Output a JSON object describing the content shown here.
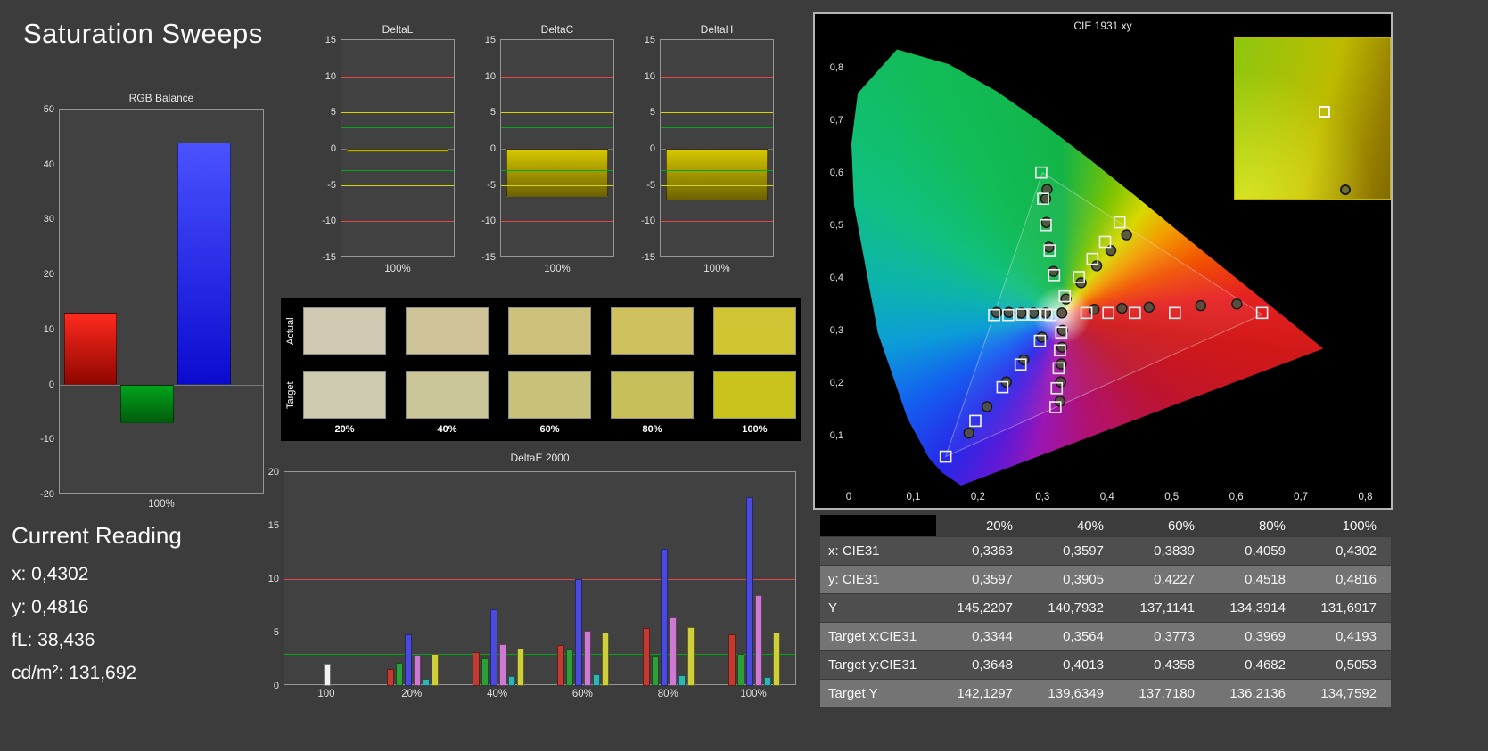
{
  "page": {
    "title": "Saturation Sweeps",
    "bg": "#3c3c3c"
  },
  "current_reading": {
    "heading": "Current Reading",
    "lines": [
      "x: 0,4302",
      "y: 0,4816",
      "fL: 38,436",
      "cd/m²: 131,692"
    ]
  },
  "rgb_balance": {
    "type": "bar",
    "title": "RGB Balance",
    "categories": [
      "Red",
      "Green",
      "Blue"
    ],
    "values": [
      13,
      -7,
      44
    ],
    "gradients": [
      [
        "#ff2a1e",
        "#8f0600"
      ],
      [
        "#00a41c",
        "#005c0c"
      ],
      [
        "#4a52ff",
        "#0b0bd0"
      ]
    ],
    "ylim": [
      -20,
      50
    ],
    "yticks": [
      "50",
      "40",
      "30",
      "20",
      "10",
      "0",
      "-10",
      "-20"
    ],
    "xlabel": "100%"
  },
  "delta_axis": {
    "ylim": [
      -15,
      15
    ],
    "yticks": [
      "15",
      "10",
      "5",
      "0",
      "-5",
      "-10",
      "-15"
    ],
    "ref_lines": [
      {
        "value": 10,
        "color": "#e04848"
      },
      {
        "value": 5,
        "color": "#d6d600"
      },
      {
        "value": 3,
        "color": "#00a816"
      },
      {
        "value": -3,
        "color": "#00a816"
      },
      {
        "value": -5,
        "color": "#d6d600"
      },
      {
        "value": -10,
        "color": "#e04848"
      }
    ],
    "bar_gradient": [
      "#d6c800",
      "#6d6200"
    ]
  },
  "delta_charts": [
    {
      "title": "DeltaL",
      "value": -0.5,
      "xlabel": "100%"
    },
    {
      "title": "DeltaC",
      "value": -6.6,
      "xlabel": "100%"
    },
    {
      "title": "DeltaH",
      "value": -7.1,
      "xlabel": "100%"
    }
  ],
  "swatches": {
    "row_labels": [
      "Actual",
      "Target"
    ],
    "col_labels": [
      "20%",
      "40%",
      "60%",
      "80%",
      "100%"
    ],
    "actual": [
      "#cfc9b1",
      "#cfc497",
      "#cec17b",
      "#cfc25e",
      "#d1c534"
    ],
    "target": [
      "#cecaaf",
      "#cbc697",
      "#c8c179",
      "#c6bf5a",
      "#c9c31e"
    ]
  },
  "deltae": {
    "type": "bar",
    "title": "DeltaE 2000",
    "categories": [
      "100",
      "20%",
      "40%",
      "60%",
      "80%",
      "100%"
    ],
    "series": [
      {
        "name": "white",
        "color": "#f2f2f2",
        "values": [
          2.1,
          null,
          null,
          null,
          null,
          null
        ]
      },
      {
        "name": "red",
        "color": "#c23a30",
        "values": [
          null,
          1.6,
          3.2,
          3.8,
          5.4,
          4.8
        ]
      },
      {
        "name": "green",
        "color": "#2e9e38",
        "values": [
          null,
          2.2,
          2.6,
          3.4,
          2.8,
          3.0
        ]
      },
      {
        "name": "blue",
        "color": "#4a4ae0",
        "values": [
          null,
          4.8,
          7.2,
          10.0,
          12.8,
          17.7
        ]
      },
      {
        "name": "magenta",
        "color": "#cf7ad2",
        "values": [
          null,
          2.9,
          3.9,
          5.2,
          6.4,
          8.5
        ]
      },
      {
        "name": "cyan",
        "color": "#30b4b4",
        "values": [
          null,
          0.7,
          0.9,
          1.1,
          1.0,
          0.8
        ]
      },
      {
        "name": "yellow",
        "color": "#cfcf3c",
        "values": [
          null,
          3.0,
          3.5,
          5.0,
          5.5,
          5.0
        ]
      }
    ],
    "ylim": [
      0,
      20
    ],
    "yticks": [
      "20",
      "15",
      "10",
      "5",
      "0"
    ],
    "ref_lines": [
      {
        "value": 10,
        "color": "#e04848"
      },
      {
        "value": 5,
        "color": "#d6d600"
      },
      {
        "value": 3,
        "color": "#00a816"
      }
    ]
  },
  "cie": {
    "type": "scatter",
    "title": "CIE 1931 xy",
    "xticks": [
      "0",
      "0,1",
      "0,2",
      "0,3",
      "0,4",
      "0,5",
      "0,6",
      "0,7",
      "0,8"
    ],
    "yticks": [
      "0,8",
      "0,7",
      "0,6",
      "0,5",
      "0,4",
      "0,3",
      "0,2",
      "0,1"
    ],
    "xrange": [
      0,
      0.82
    ],
    "yrange": [
      0,
      0.85
    ],
    "triangle": [
      [
        0.64,
        0.33
      ],
      [
        0.3,
        0.6
      ],
      [
        0.15,
        0.06
      ]
    ],
    "targets": {
      "white": [
        [
          0.3127,
          0.329
        ]
      ],
      "red": [
        [
          0.368,
          0.333
        ],
        [
          0.402,
          0.333
        ],
        [
          0.443,
          0.333
        ],
        [
          0.505,
          0.333
        ],
        [
          0.64,
          0.333
        ]
      ],
      "green": [
        [
          0.318,
          0.405
        ],
        [
          0.311,
          0.452
        ],
        [
          0.305,
          0.5
        ],
        [
          0.301,
          0.55
        ],
        [
          0.298,
          0.6
        ]
      ],
      "blue": [
        [
          0.296,
          0.28
        ],
        [
          0.266,
          0.235
        ],
        [
          0.238,
          0.192
        ],
        [
          0.196,
          0.128
        ],
        [
          0.15,
          0.06
        ]
      ],
      "cyan": [
        [
          0.306,
          0.33
        ],
        [
          0.287,
          0.33
        ],
        [
          0.268,
          0.33
        ],
        [
          0.247,
          0.329
        ],
        [
          0.225,
          0.329
        ]
      ],
      "magenta": [
        [
          0.329,
          0.296
        ],
        [
          0.327,
          0.262
        ],
        [
          0.325,
          0.228
        ],
        [
          0.322,
          0.19
        ],
        [
          0.32,
          0.154
        ]
      ],
      "yellow": [
        [
          0.3344,
          0.3648
        ],
        [
          0.3564,
          0.4013
        ],
        [
          0.3773,
          0.4358
        ],
        [
          0.3969,
          0.4682
        ],
        [
          0.4193,
          0.5053
        ]
      ]
    },
    "measurements": {
      "white": [
        [
          0.33,
          0.333
        ]
      ],
      "red": [
        [
          0.38,
          0.34
        ],
        [
          0.423,
          0.342
        ],
        [
          0.465,
          0.344
        ],
        [
          0.545,
          0.347
        ],
        [
          0.601,
          0.35
        ]
      ],
      "green": [
        [
          0.317,
          0.412
        ],
        [
          0.31,
          0.458
        ],
        [
          0.306,
          0.505
        ],
        [
          0.305,
          0.55
        ],
        [
          0.307,
          0.568
        ]
      ],
      "blue": [
        [
          0.299,
          0.287
        ],
        [
          0.271,
          0.244
        ],
        [
          0.244,
          0.202
        ],
        [
          0.214,
          0.155
        ],
        [
          0.186,
          0.105
        ]
      ],
      "cyan": [
        [
          0.305,
          0.333
        ],
        [
          0.286,
          0.333
        ],
        [
          0.267,
          0.333
        ],
        [
          0.248,
          0.334
        ],
        [
          0.229,
          0.334
        ]
      ],
      "magenta": [
        [
          0.331,
          0.3
        ],
        [
          0.33,
          0.268
        ],
        [
          0.329,
          0.236
        ],
        [
          0.328,
          0.202
        ],
        [
          0.327,
          0.165
        ]
      ],
      "yellow": [
        [
          0.3363,
          0.3597
        ],
        [
          0.3597,
          0.3905
        ],
        [
          0.3839,
          0.4227
        ],
        [
          0.4059,
          0.4518
        ],
        [
          0.4302,
          0.4816
        ]
      ]
    }
  },
  "table": {
    "header": [
      "",
      "20%",
      "40%",
      "60%",
      "80%",
      "100%"
    ],
    "rows": [
      {
        "label": "x: CIE31",
        "values": [
          "0,3363",
          "0,3597",
          "0,3839",
          "0,4059",
          "0,4302"
        ]
      },
      {
        "label": "y: CIE31",
        "values": [
          "0,3597",
          "0,3905",
          "0,4227",
          "0,4518",
          "0,4816"
        ]
      },
      {
        "label": "Y",
        "values": [
          "145,2207",
          "140,7932",
          "137,1141",
          "134,3914",
          "131,6917"
        ]
      },
      {
        "label": "Target x:CIE31",
        "values": [
          "0,3344",
          "0,3564",
          "0,3773",
          "0,3969",
          "0,4193"
        ]
      },
      {
        "label": "Target y:CIE31",
        "values": [
          "0,3648",
          "0,4013",
          "0,4358",
          "0,4682",
          "0,5053"
        ]
      },
      {
        "label": "Target Y",
        "values": [
          "142,1297",
          "139,6349",
          "137,7180",
          "136,2136",
          "134,7592"
        ]
      }
    ]
  }
}
